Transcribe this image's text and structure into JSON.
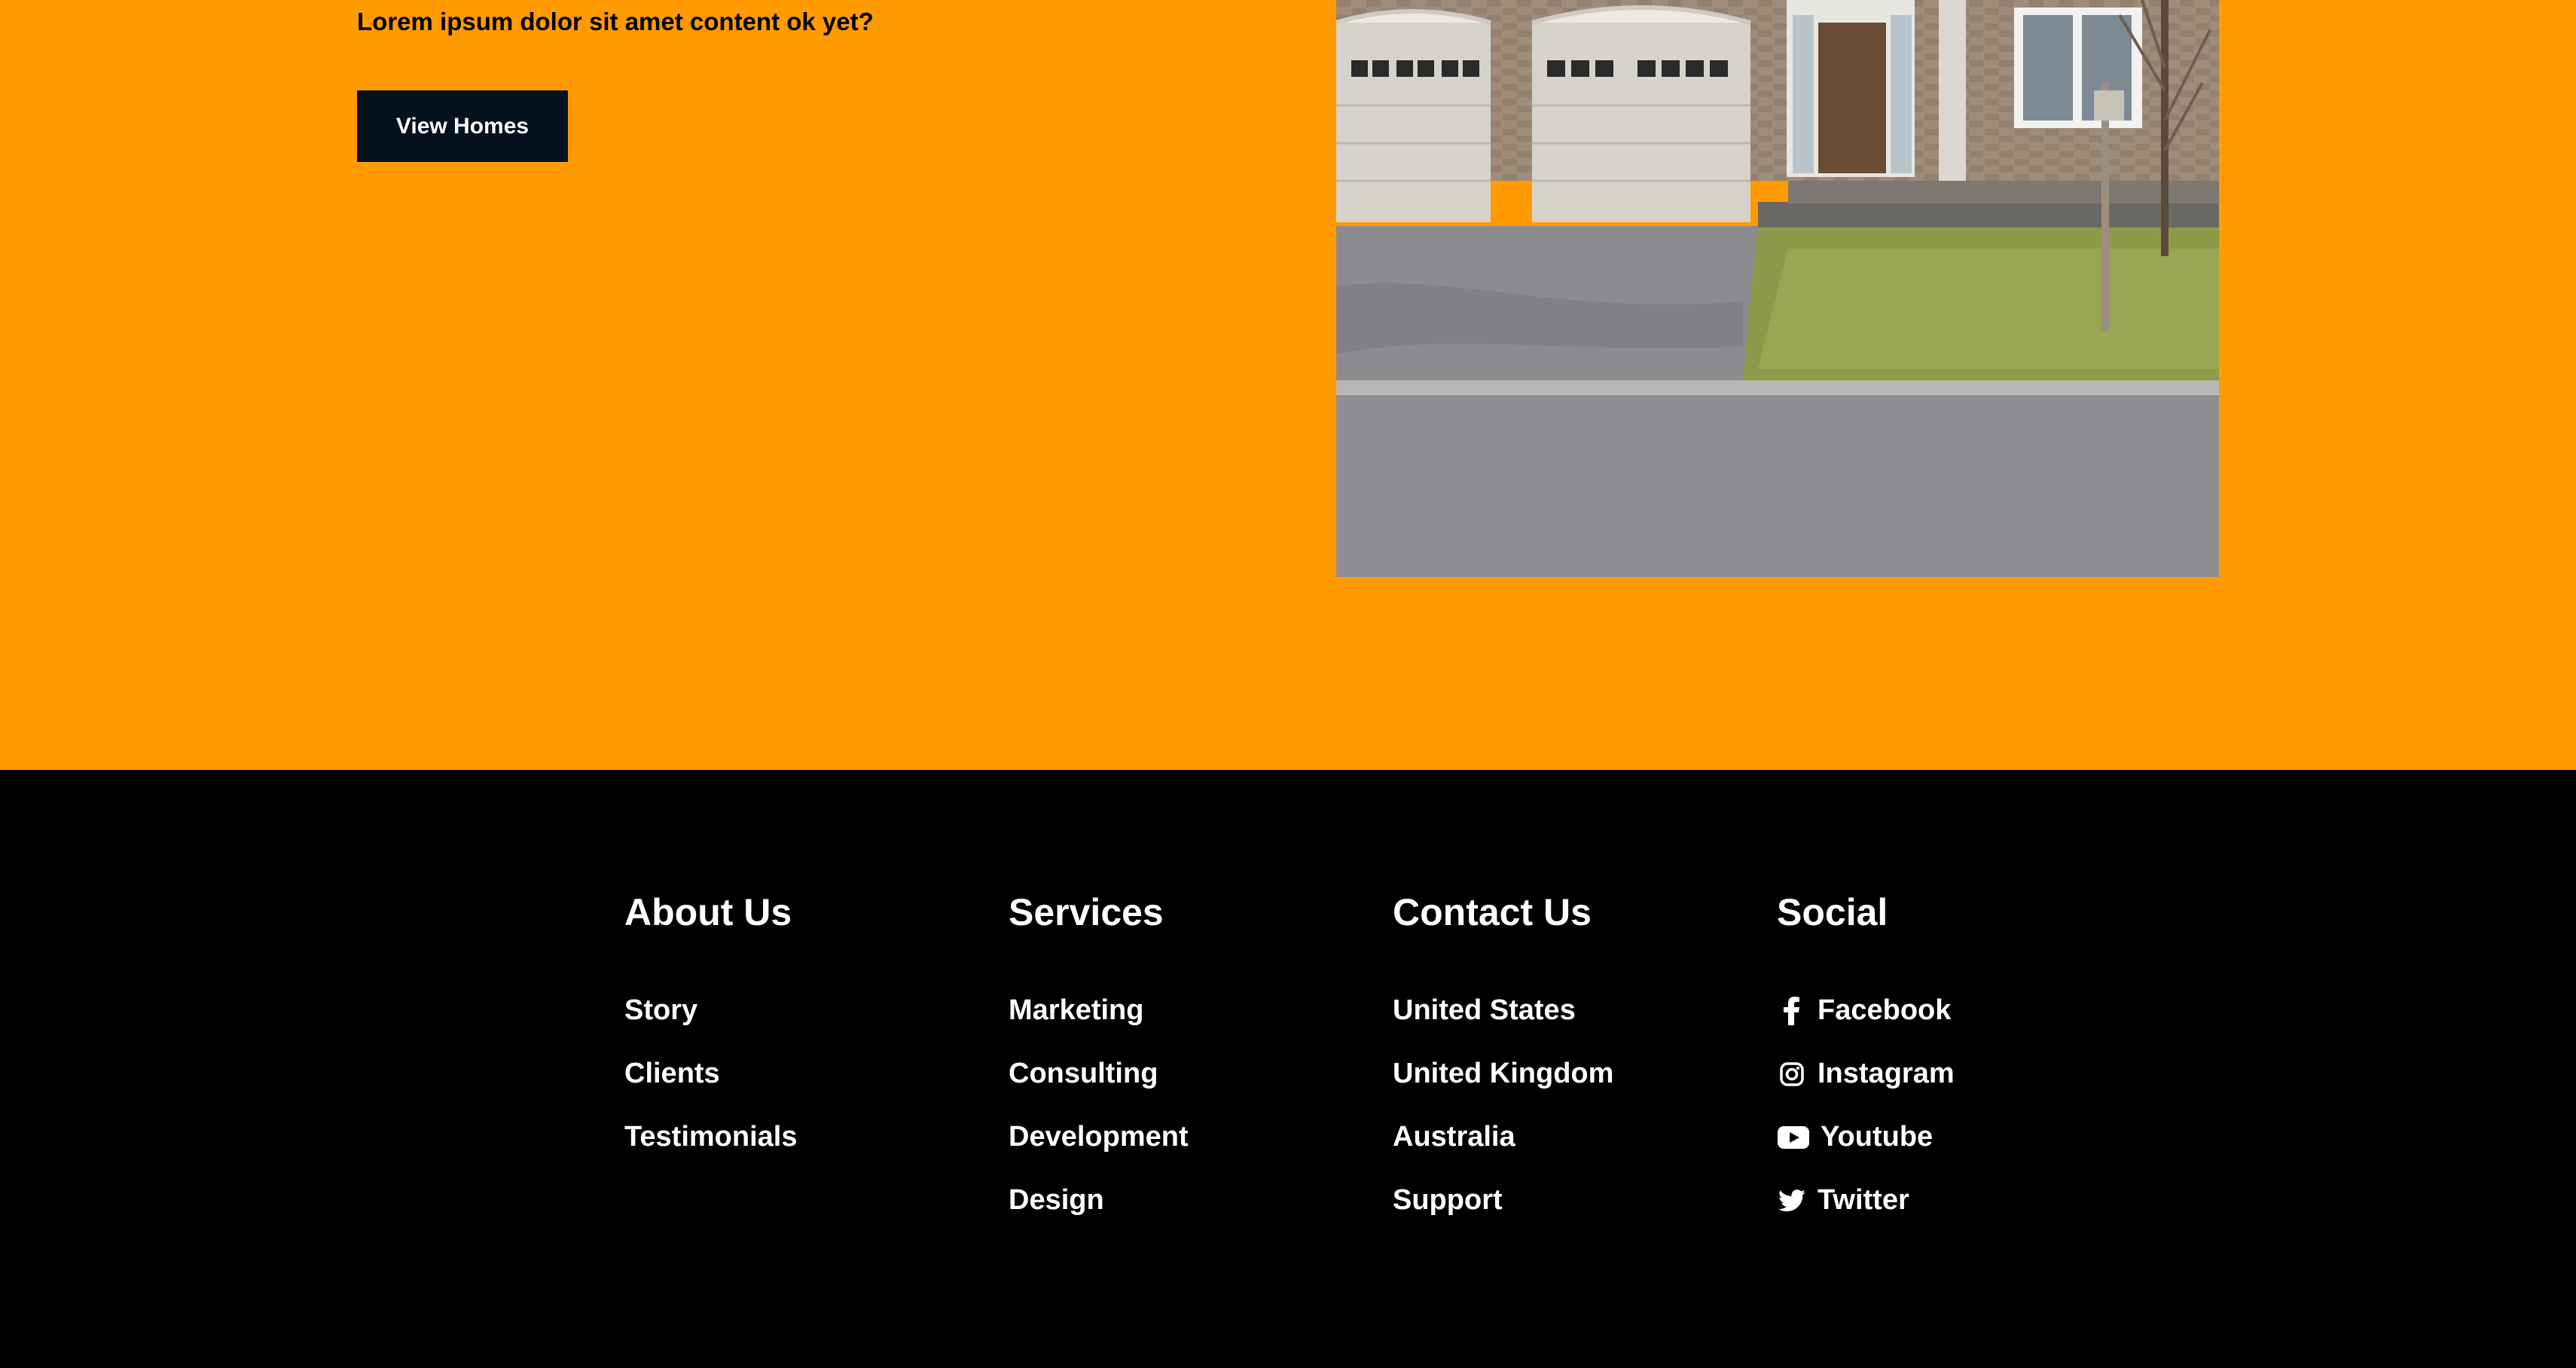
{
  "hero": {
    "tagline": "Lorem ipsum dolor sit amet content ok yet?",
    "cta_label": "View Homes",
    "bg_color": "#ff9b00",
    "cta_color": "#05121e"
  },
  "footer": {
    "bg_color": "#000000",
    "columns": [
      {
        "title": "About Us",
        "links": [
          "Story",
          "Clients",
          "Testimonials"
        ]
      },
      {
        "title": "Services",
        "links": [
          "Marketing",
          "Consulting",
          "Development",
          "Design"
        ]
      },
      {
        "title": "Contact Us",
        "links": [
          "United States",
          "United Kingdom",
          "Australia",
          "Support"
        ]
      },
      {
        "title": "Social",
        "links": [
          {
            "label": "Facebook",
            "icon": "facebook-icon"
          },
          {
            "label": "Instagram",
            "icon": "instagram-icon"
          },
          {
            "label": "Youtube",
            "icon": "youtube-icon"
          },
          {
            "label": "Twitter",
            "icon": "twitter-icon"
          }
        ]
      }
    ]
  }
}
